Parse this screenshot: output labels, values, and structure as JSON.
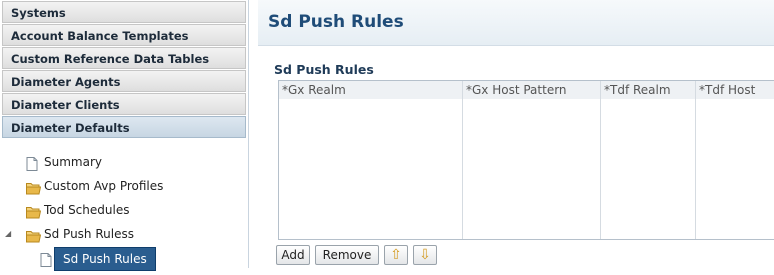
{
  "nav": {
    "sections": [
      {
        "label": "Systems"
      },
      {
        "label": "Account Balance Templates"
      },
      {
        "label": "Custom Reference Data Tables"
      },
      {
        "label": "Diameter Agents"
      },
      {
        "label": "Diameter Clients"
      },
      {
        "label": "Diameter Defaults",
        "selected": true
      }
    ],
    "tree": [
      {
        "label": "Summary",
        "icon": "document-icon"
      },
      {
        "label": "Custom Avp Profiles",
        "icon": "folder-icon"
      },
      {
        "label": "Tod Schedules",
        "icon": "folder-icon"
      },
      {
        "label": "Sd Push Ruless",
        "icon": "folder-icon",
        "expanded": true
      },
      {
        "label": "Sd Push Rules",
        "icon": "document-icon",
        "selected": true
      }
    ]
  },
  "page": {
    "title": "Sd Push Rules",
    "section_title": "Sd Push Rules"
  },
  "table": {
    "columns": [
      "*Gx Realm",
      "*Gx Host Pattern",
      "*Tdf Realm",
      "*Tdf Host"
    ],
    "rows": []
  },
  "toolbar": {
    "add_label": "Add",
    "remove_label": "Remove",
    "move_up_icon": "arrow-up-icon",
    "move_down_icon": "arrow-down-icon"
  },
  "colors": {
    "accent": "#1f4c78",
    "selection": "#2a5d8f",
    "folder": "#e8b84a"
  }
}
